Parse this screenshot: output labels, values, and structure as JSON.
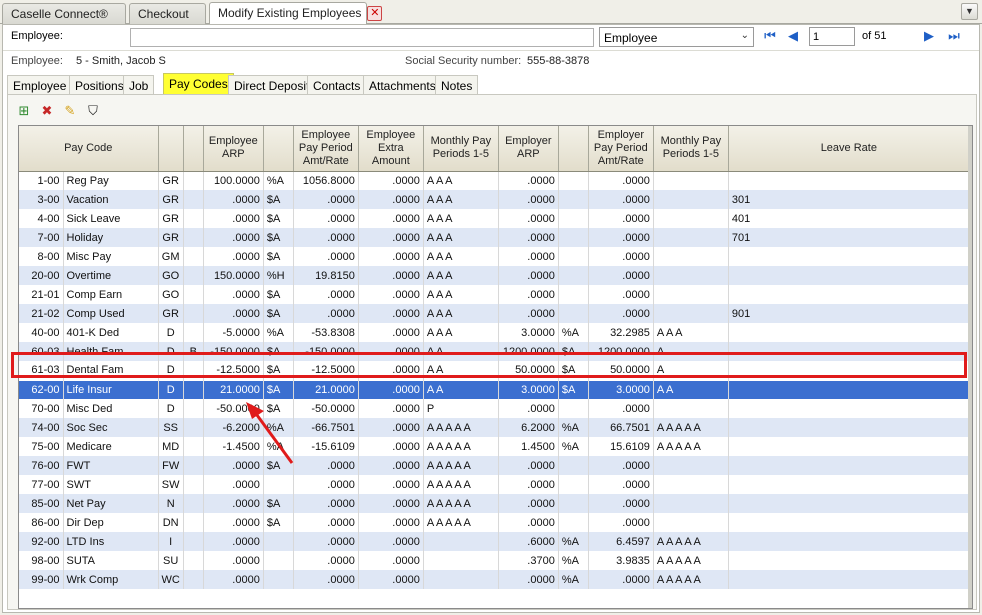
{
  "doc_tabs": [
    {
      "label": "Caselle Connect®"
    },
    {
      "label": "Checkout"
    },
    {
      "label": "Modify Existing Employees"
    }
  ],
  "search": {
    "label": "Employee:",
    "value": "",
    "type_selected": "Employee",
    "page": "1",
    "of_pages": "of 51"
  },
  "employee_info": {
    "emp_label": "Employee:",
    "emp_value": "5 - Smith, Jacob S",
    "ssn_label": "Social Security number:",
    "ssn_value": "555-88-3878"
  },
  "subtabs": [
    "Employee",
    "Positions",
    "Job",
    "Pay Codes",
    "Direct Deposit",
    "Contacts",
    "Attachments",
    "Notes"
  ],
  "active_subtab": "Pay Codes",
  "toolbar_icons": [
    "add-row-icon",
    "delete-row-icon",
    "edit-pencil-icon",
    "filter-icon"
  ],
  "grid": {
    "headers": [
      "Pay Code",
      "",
      "",
      "Employee ARP",
      "",
      "Employee Pay Period Amt/Rate",
      "Employee Extra Amount",
      "Monthly Pay Periods 1-5",
      "Employer ARP",
      "",
      "Employer Pay Period Amt/Rate",
      "Monthly Pay Periods 1-5",
      "Leave Rate"
    ],
    "rows": [
      [
        "1-00",
        "Reg Pay",
        "GR",
        "",
        "100.0000",
        "%A",
        "1056.8000",
        ".0000",
        "A A A",
        ".0000",
        "",
        ".0000",
        "",
        ""
      ],
      [
        "3-00",
        "Vacation",
        "GR",
        "",
        ".0000",
        "$A",
        ".0000",
        ".0000",
        "A A A",
        ".0000",
        "",
        ".0000",
        "",
        "301"
      ],
      [
        "4-00",
        "Sick Leave",
        "GR",
        "",
        ".0000",
        "$A",
        ".0000",
        ".0000",
        "A A A",
        ".0000",
        "",
        ".0000",
        "",
        "401"
      ],
      [
        "7-00",
        "Holiday",
        "GR",
        "",
        ".0000",
        "$A",
        ".0000",
        ".0000",
        "A A A",
        ".0000",
        "",
        ".0000",
        "",
        "701"
      ],
      [
        "8-00",
        "Misc Pay",
        "GM",
        "",
        ".0000",
        "$A",
        ".0000",
        ".0000",
        "A A A",
        ".0000",
        "",
        ".0000",
        "",
        ""
      ],
      [
        "20-00",
        "Overtime",
        "GO",
        "",
        "150.0000",
        "%H",
        "19.8150",
        ".0000",
        "A A A",
        ".0000",
        "",
        ".0000",
        "",
        ""
      ],
      [
        "21-01",
        "Comp Earn",
        "GO",
        "",
        ".0000",
        "$A",
        ".0000",
        ".0000",
        "A A A",
        ".0000",
        "",
        ".0000",
        "",
        ""
      ],
      [
        "21-02",
        "Comp Used",
        "GR",
        "",
        ".0000",
        "$A",
        ".0000",
        ".0000",
        "A A A",
        ".0000",
        "",
        ".0000",
        "",
        "901"
      ],
      [
        "40-00",
        "401-K Ded",
        "D",
        "",
        "-5.0000",
        "%A",
        "-53.8308",
        ".0000",
        "A A A",
        "3.0000",
        "%A",
        "32.2985",
        "A A A",
        ""
      ],
      [
        "60-03",
        "Health Fam",
        "D",
        "B",
        "-150.0000",
        "$A",
        "-150.0000",
        ".0000",
        "A A",
        "1200.0000",
        "$A",
        "1200.0000",
        "A",
        ""
      ],
      [
        "61-03",
        "Dental Fam",
        "D",
        "",
        "-12.5000",
        "$A",
        "-12.5000",
        ".0000",
        "A A",
        "50.0000",
        "$A",
        "50.0000",
        "A",
        ""
      ],
      [
        "62-00",
        "Life Insur",
        "D",
        "",
        "21.0000",
        "$A",
        "21.0000",
        ".0000",
        "A A",
        "3.0000",
        "$A",
        "3.0000",
        "A A",
        ""
      ],
      [
        "70-00",
        "Misc Ded",
        "D",
        "",
        "-50.0000",
        "$A",
        "-50.0000",
        ".0000",
        "P",
        ".0000",
        "",
        ".0000",
        "",
        ""
      ],
      [
        "74-00",
        "Soc Sec",
        "SS",
        "",
        "-6.2000",
        "%A",
        "-66.7501",
        ".0000",
        "A A A A A",
        "6.2000",
        "%A",
        "66.7501",
        "A A A A A",
        ""
      ],
      [
        "75-00",
        "Medicare",
        "MD",
        "",
        "-1.4500",
        "%A",
        "-15.6109",
        ".0000",
        "A A A A A",
        "1.4500",
        "%A",
        "15.6109",
        "A A A A A",
        ""
      ],
      [
        "76-00",
        "FWT",
        "FW",
        "",
        ".0000",
        "$A",
        ".0000",
        ".0000",
        "A A A A A",
        ".0000",
        "",
        ".0000",
        "",
        ""
      ],
      [
        "77-00",
        "SWT",
        "SW",
        "",
        ".0000",
        "",
        ".0000",
        ".0000",
        "A A A A A",
        ".0000",
        "",
        ".0000",
        "",
        ""
      ],
      [
        "85-00",
        "Net Pay",
        "N",
        "",
        ".0000",
        "$A",
        ".0000",
        ".0000",
        "A A A A A",
        ".0000",
        "",
        ".0000",
        "",
        ""
      ],
      [
        "86-00",
        "Dir Dep",
        "DN",
        "",
        ".0000",
        "$A",
        ".0000",
        ".0000",
        "A A A A A",
        ".0000",
        "",
        ".0000",
        "",
        ""
      ],
      [
        "92-00",
        "LTD Ins",
        "I",
        "",
        ".0000",
        "",
        ".0000",
        ".0000",
        "",
        ".6000",
        "%A",
        "6.4597",
        "A A A A A",
        ""
      ],
      [
        "98-00",
        "SUTA",
        "SU",
        "",
        ".0000",
        "",
        ".0000",
        ".0000",
        "",
        ".3700",
        "%A",
        "3.9835",
        "A A A A A",
        ""
      ],
      [
        "99-00",
        "Wrk Comp",
        "WC",
        "",
        ".0000",
        "",
        ".0000",
        ".0000",
        "",
        ".0000",
        "%A",
        ".0000",
        "A A A A A",
        ""
      ]
    ],
    "selected_row_index": 11
  },
  "colors": {
    "selected_row": "#3b6fd0",
    "alt_row": "#dfe7f5",
    "active_tab": "#ffff33",
    "annotation": "#e01b1b"
  }
}
